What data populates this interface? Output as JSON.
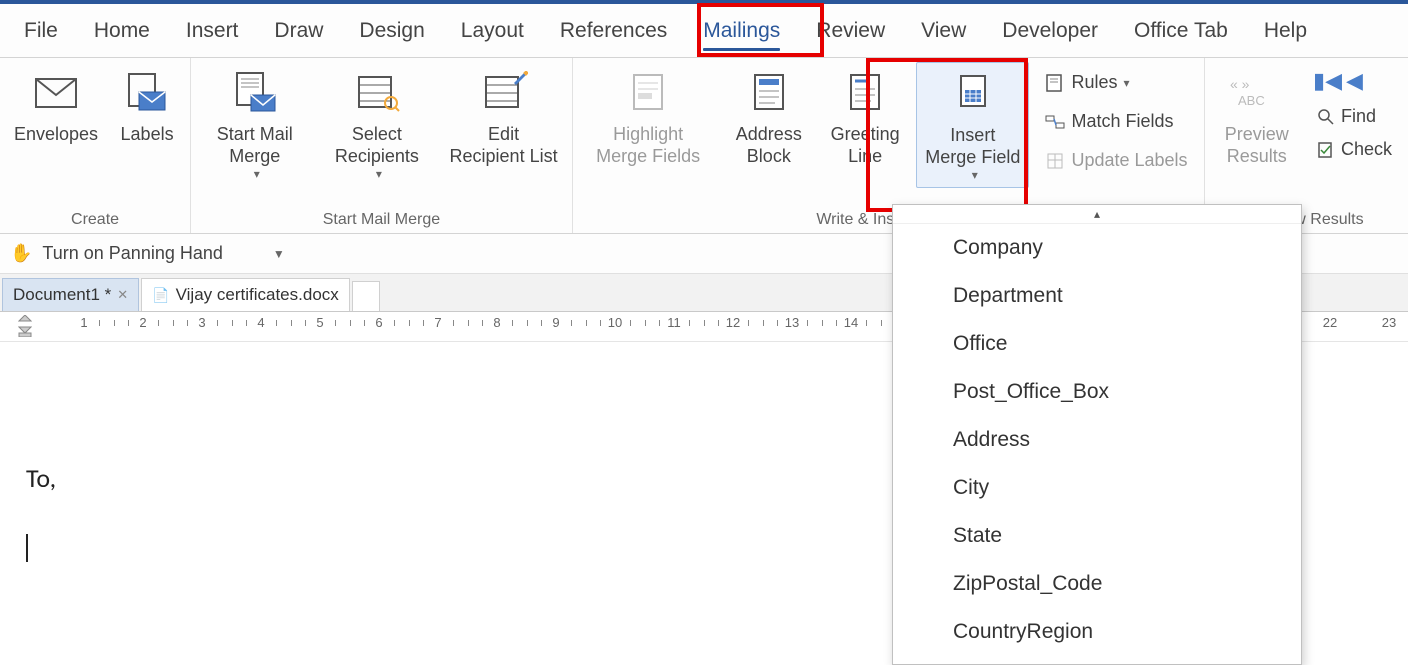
{
  "tabs": {
    "file": "File",
    "home": "Home",
    "insert": "Insert",
    "draw": "Draw",
    "design": "Design",
    "layout": "Layout",
    "references": "References",
    "mailings": "Mailings",
    "review": "Review",
    "view": "View",
    "developer": "Developer",
    "officetab": "Office Tab",
    "help": "Help"
  },
  "ribbon": {
    "create": {
      "label": "Create",
      "envelopes": "Envelopes",
      "labels": "Labels"
    },
    "startmm": {
      "label": "Start Mail Merge",
      "start": "Start Mail Merge",
      "select": "Select Recipients",
      "edit": "Edit Recipient List"
    },
    "write": {
      "label": "Write & Insert Fields",
      "highlight": "Highlight Merge Fields",
      "address": "Address Block",
      "greeting": "Greeting Line",
      "insertmerge": "Insert Merge Field",
      "rules": "Rules",
      "match": "Match Fields",
      "update": "Update Labels"
    },
    "preview": {
      "label": "Preview Results",
      "preview": "Preview Results",
      "find": "Find",
      "check": "Check"
    }
  },
  "qat": {
    "panning": "Turn on Panning Hand"
  },
  "doctabs": {
    "doc1": "Document1 *",
    "doc2": "Vijay certificates.docx"
  },
  "ruler": {
    "labels": [
      "1",
      "2",
      "3",
      "4",
      "5",
      "6",
      "7",
      "8",
      "9",
      "10",
      "11",
      "12",
      "13",
      "14",
      "22",
      "23"
    ]
  },
  "document": {
    "to": "To,"
  },
  "dropdown": {
    "items": [
      "Company",
      "Department",
      "Office",
      "Post_Office_Box",
      "Address",
      "City",
      "State",
      "ZipPostal_Code",
      "CountryRegion"
    ]
  }
}
